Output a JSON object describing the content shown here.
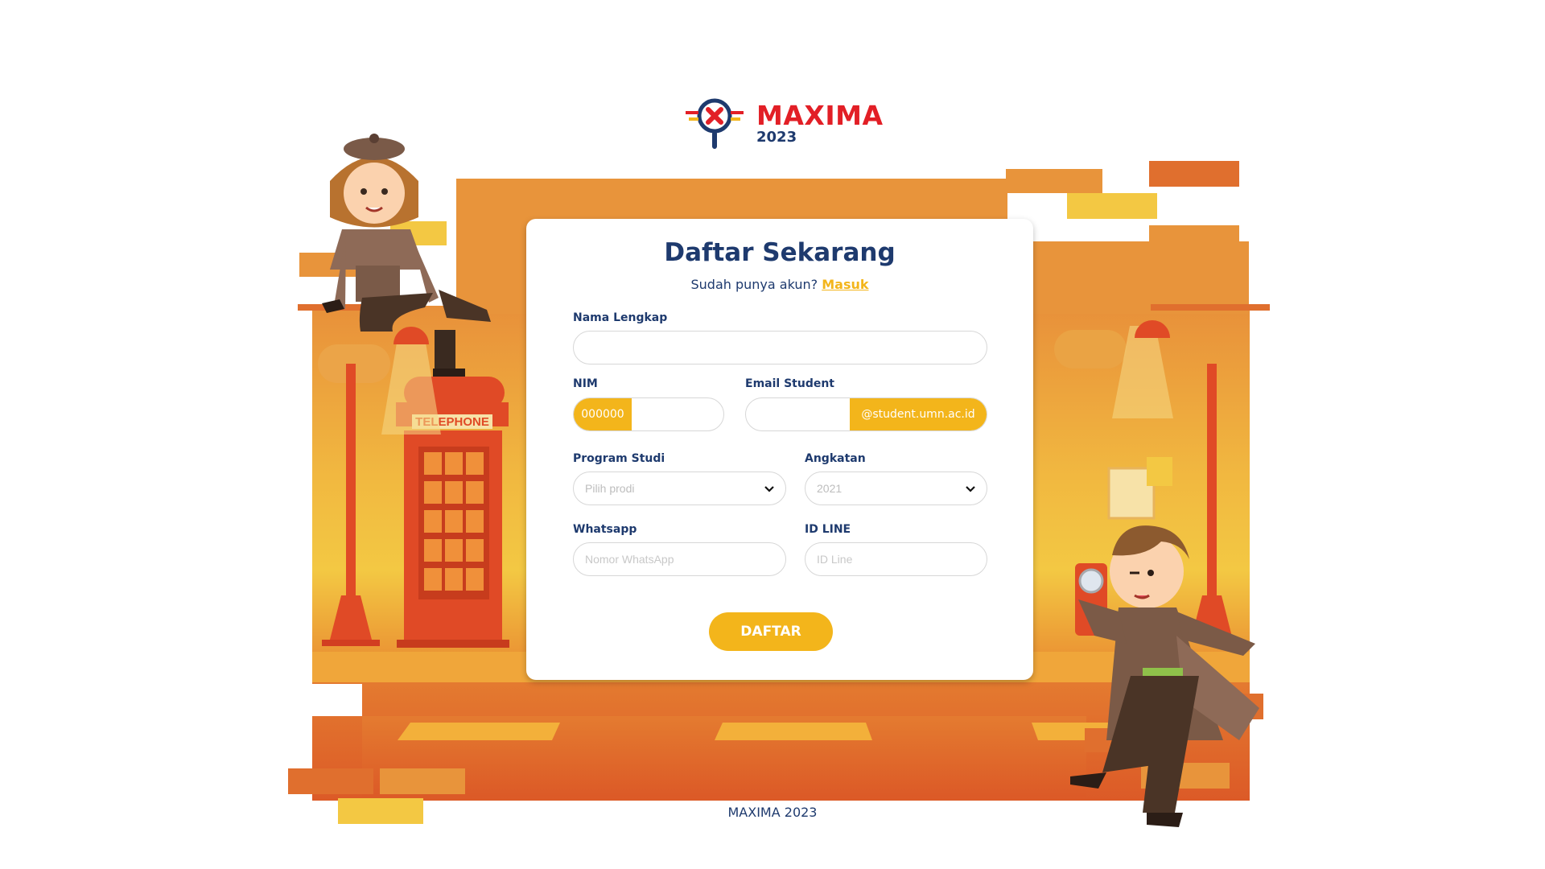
{
  "brand": {
    "name": "MAXIMA",
    "year": "2023",
    "accent": "#e21f26",
    "navy": "#1e3a6e",
    "yellow": "#f3b51b"
  },
  "scene": {
    "telephone_sign": "TELEPHONE"
  },
  "form": {
    "title": "Daftar Sekarang",
    "subtitle_prefix": "Sudah punya akun?",
    "login_link": "Masuk",
    "nama": {
      "label": "Nama Lengkap",
      "value": ""
    },
    "nim": {
      "label": "NIM",
      "prefix": "000000",
      "value": ""
    },
    "email": {
      "label": "Email Student",
      "suffix": "@student.umn.ac.id",
      "value": ""
    },
    "prodi": {
      "label": "Program Studi",
      "placeholder": "Pilih prodi"
    },
    "angkatan": {
      "label": "Angkatan",
      "value": "2021"
    },
    "whatsapp": {
      "label": "Whatsapp",
      "placeholder": "Nomor WhatsApp"
    },
    "line": {
      "label": "ID LINE",
      "placeholder": "ID Line"
    },
    "submit_label": "DAFTAR"
  },
  "footer": {
    "text": "MAXIMA 2023"
  }
}
